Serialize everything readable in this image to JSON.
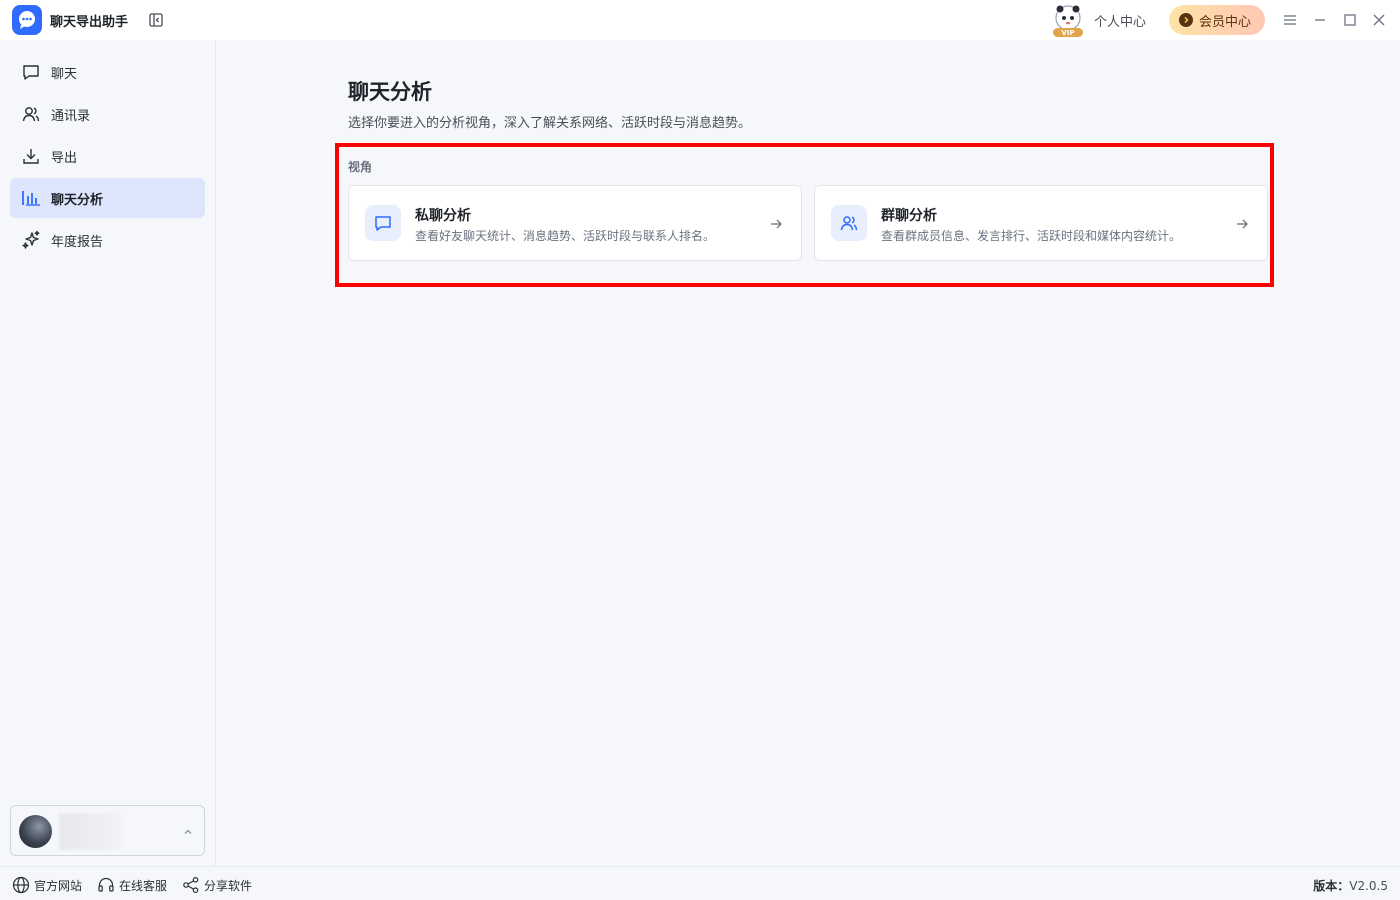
{
  "app": {
    "title": "聊天导出助手",
    "personal_center": "个人中心",
    "member_center": "会员中心",
    "vip_badge": "VIP"
  },
  "sidebar": {
    "items": [
      {
        "label": "聊天",
        "icon": "chat-bubble-icon",
        "active": false
      },
      {
        "label": "通讯录",
        "icon": "contacts-icon",
        "active": false
      },
      {
        "label": "导出",
        "icon": "download-icon",
        "active": false
      },
      {
        "label": "聊天分析",
        "icon": "bar-chart-icon",
        "active": true
      },
      {
        "label": "年度报告",
        "icon": "sparkles-icon",
        "active": false
      }
    ]
  },
  "main": {
    "title": "聊天分析",
    "subtitle": "选择你要进入的分析视角，深入了解关系网络、活跃时段与消息趋势。",
    "section_label": "视角",
    "cards": [
      {
        "title": "私聊分析",
        "desc": "查看好友聊天统计、消息趋势、活跃时段与联系人排名。",
        "icon": "chat-bubble-icon"
      },
      {
        "title": "群聊分析",
        "desc": "查看群成员信息、发言排行、活跃时段和媒体内容统计。",
        "icon": "users-icon"
      }
    ]
  },
  "footer": {
    "links": [
      {
        "label": "官方网站",
        "icon": "globe-icon"
      },
      {
        "label": "在线客服",
        "icon": "headset-icon"
      },
      {
        "label": "分享软件",
        "icon": "share-icon"
      }
    ],
    "version_label": "版本：",
    "version_value": "V2.0.5"
  },
  "colors": {
    "accent": "#2f6bff",
    "active_bg": "#dce5fb",
    "highlight": "#ff0000"
  }
}
